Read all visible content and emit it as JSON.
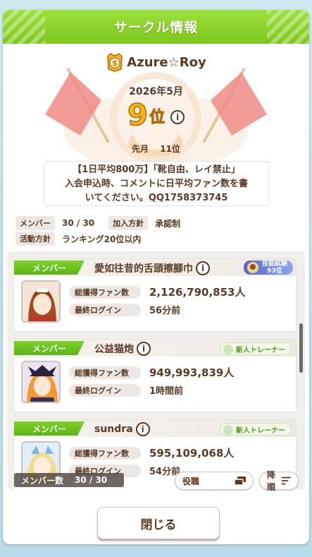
{
  "header": {
    "title": "サークル情報"
  },
  "club": {
    "name": "Azure☆Roy",
    "month": "2026年5月",
    "rank_number": "9",
    "rank_suffix": "位",
    "info_glyph": "i",
    "prev_label": "先月",
    "prev_rank": "11位",
    "description_lines": [
      "【1日平均800万】「靴自由、レイ禁止」",
      "入会申込時、コメントに日平均ファン数を書",
      "いてください。QQ1758373745"
    ]
  },
  "meta": {
    "member_label": "メンバー",
    "member_value": "30 / 30",
    "join_label": "加入方針",
    "join_value": "承認制",
    "activity_label": "活動方針",
    "activity_value": "ランキング20位以内"
  },
  "members": [
    {
      "role": "メンバー",
      "name": "愛如往昔的舌頭擦腳巾",
      "badge_type": "skill",
      "badge_line1": "技能試験",
      "badge_line2": "93位",
      "fans_label": "総獲得ファン数",
      "fans_value": "2,126,790,853人",
      "login_label": "最終ログイン",
      "login_value": "56分前"
    },
    {
      "role": "メンバー",
      "name": "公益猫炮",
      "badge_type": "trainer",
      "badge_line1": "新人トレーナー",
      "fans_label": "総獲得ファン数",
      "fans_value": "949,993,839人",
      "login_label": "最終ログイン",
      "login_value": "1時間前"
    },
    {
      "role": "メンバー",
      "name": "sundra",
      "badge_type": "trainer",
      "badge_line1": "新人トレーナー",
      "fans_label": "総獲得ファン数",
      "fans_value": "595,109,068人",
      "login_label": "最終ログイン",
      "login_value": "54分前"
    }
  ],
  "footer": {
    "count_label": "メンバー数",
    "count_value": "30 / 30",
    "role_button": "役職",
    "order_button": "降順",
    "close_button": "閉じる"
  },
  "colors": {
    "header_green": "#7cc81c",
    "text_brown": "#5a3a22",
    "rank_gold": "#f5b418",
    "role_green": "#5bb514"
  },
  "icons": [
    "club-emblem-icon",
    "info-icon",
    "list-icon",
    "sort-icon",
    "trainer-badge-icon",
    "skill-badge-icon"
  ]
}
